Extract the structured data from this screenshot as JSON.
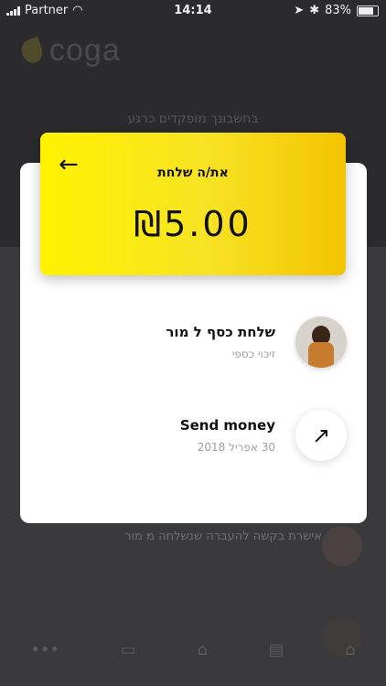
{
  "status_bar": {
    "carrier": "Partner",
    "time": "14:14",
    "battery": "83%"
  },
  "background": {
    "logo_text": "coga",
    "caption": "בחשבונך מופקדים כרגע",
    "row_text": "אישרת בקשה להעברה שנשלחה מ מור"
  },
  "modal": {
    "back_icon": "arrow-left-icon",
    "label": "את/ה שלחת",
    "amount": "₪5.00",
    "items": [
      {
        "title": "שלחת כסף ל מור",
        "subtitle": "זיכוי כספי",
        "icon": "user-photo"
      },
      {
        "title": "Send money",
        "subtitle": "30 אפריל 2018",
        "icon": "arrow-up-right-icon"
      }
    ]
  }
}
